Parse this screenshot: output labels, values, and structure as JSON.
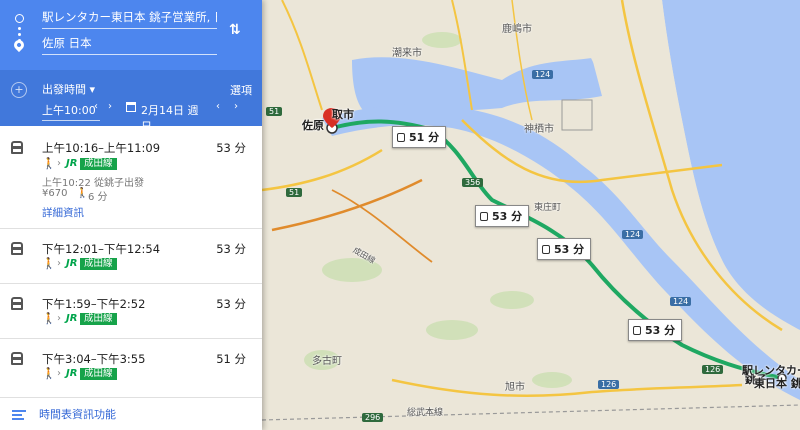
{
  "route": {
    "origin": "駅レンタカー東日本 銚子営業所, 日本",
    "destination": "佐原 日本"
  },
  "options": {
    "depart_label": "出發時間",
    "options_label": "選項",
    "time_value": "上午10:00",
    "date_value": "2月14日 週日"
  },
  "results": [
    {
      "times": "上午10:16–上午11:09",
      "duration": "53 分",
      "line": "成田線",
      "sub_departure": "上午10:22 從銚子出發",
      "fare": "¥670",
      "walk_time": "6 分",
      "details_link": "詳細資訊"
    },
    {
      "times": "下午12:01–下午12:54",
      "duration": "53 分",
      "line": "成田線"
    },
    {
      "times": "下午1:59–下午2:52",
      "duration": "53 分",
      "line": "成田線"
    },
    {
      "times": "下午3:04–下午3:55",
      "duration": "51 分",
      "line": "成田線"
    }
  ],
  "timetable_label": "時間表資訊功能",
  "map": {
    "route_labels": [
      "51 分",
      "53 分",
      "53 分",
      "53 分"
    ],
    "places": {
      "sawara": "佐原",
      "dot_city": "取市",
      "kashima": "鹿嶋市",
      "itako": "潮来市",
      "kamisu": "神栖市",
      "tonosho": "東庄町",
      "takocho": "多古町",
      "asahi": "旭市",
      "choshi": "銚子",
      "dest_label_1": "駅レンタカー",
      "dest_label_2": "東日本 銚子営",
      "road_sobu": "総武本線",
      "road_narita": "成田線"
    },
    "road_shields": [
      "51",
      "51",
      "356",
      "124",
      "124",
      "124",
      "126",
      "126",
      "296"
    ],
    "colors": {
      "route": "#1fa862",
      "header": "#4d86ee",
      "water": "#a8c5f5"
    }
  }
}
